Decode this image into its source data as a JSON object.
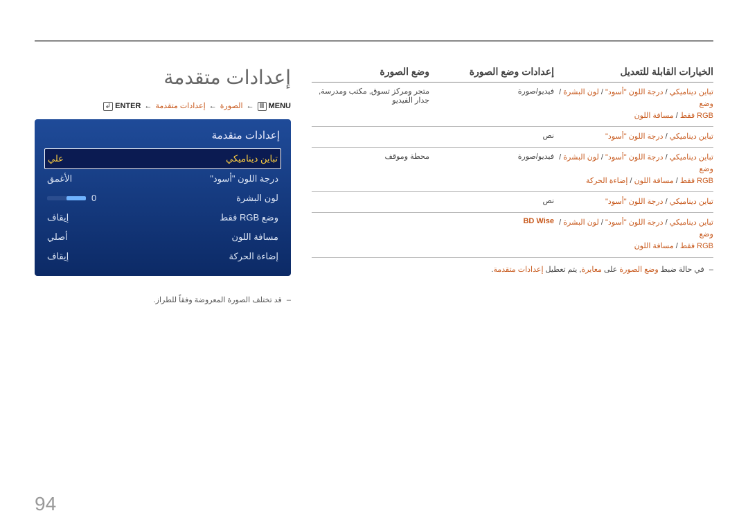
{
  "title": "إعدادات متقدمة",
  "path": {
    "menu": "MENU",
    "step1": "الصورة",
    "step2": "إعدادات متقدمة",
    "enter": "ENTER"
  },
  "panel": {
    "header": "إعدادات متقدمة",
    "rows": [
      {
        "label": "تباين ديناميكي",
        "value": "علي",
        "sel": true
      },
      {
        "label": "درجة اللون \"أسود\"",
        "value": "الأغمق"
      },
      {
        "label": "لون البشرة",
        "value": "0",
        "slider": true
      },
      {
        "label": "وضع RGB فقط",
        "value": "إيقاف"
      },
      {
        "label": "مسافة اللون",
        "value": "أصلي"
      },
      {
        "label": "إضاءة الحركة",
        "value": "إيقاف"
      }
    ]
  },
  "footnote": "قد تختلف الصورة المعروضة وفقاً للطراز.",
  "table": {
    "headers": {
      "c1": "وضع الصورة",
      "c2": "إعدادات وضع الصورة",
      "c3": "الخيارات القابلة للتعديل"
    },
    "rows": [
      {
        "c1": "متجر ومركز تسوق, مكتب ومدرسة, جدار الفيديو",
        "c2": "فيديو/صورة",
        "c3a": "تباين ديناميكي / درجة اللون \"أسود\" / لون البشرة / وضع",
        "c3b": "RGB فقط / مسافة اللون"
      },
      {
        "c1": "",
        "c2": "نص",
        "c3a": "تباين ديناميكي / درجة اللون \"أسود\"",
        "c3b": ""
      },
      {
        "c1": "محطة وموقف",
        "c2": "فيديو/صورة",
        "c3a": "تباين ديناميكي / درجة اللون \"أسود\" / لون البشرة / وضع",
        "c3b": "RGB فقط / مسافة اللون / إضاءة الحركة"
      },
      {
        "c1": "",
        "c2": "نص",
        "c3a": "تباين ديناميكي / درجة اللون \"أسود\"",
        "c3b": ""
      },
      {
        "c1": "",
        "c2": "BD Wise",
        "c3a": "تباين ديناميكي / درجة اللون \"أسود\" / لون البشرة / وضع",
        "c3b": "RGB فقط / مسافة اللون",
        "hl": true
      }
    ],
    "note_a": "في حالة ضبط ",
    "note_b": "وضع الصورة",
    "note_c": " على ",
    "note_d": "معايرة",
    "note_e": ", يتم تعطيل ",
    "note_f": "إعدادات متقدمة",
    "note_g": "."
  },
  "pageNumber": "94"
}
